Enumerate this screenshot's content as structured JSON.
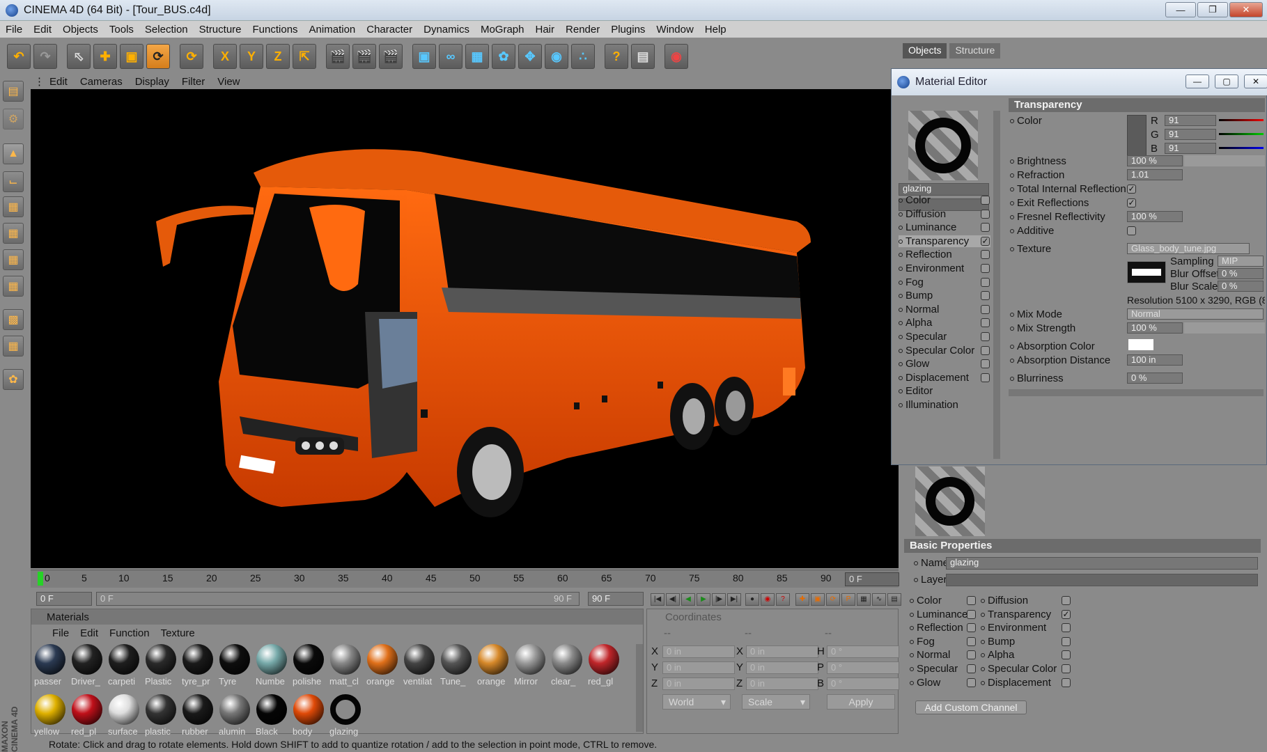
{
  "app": {
    "title": "CINEMA 4D (64 Bit) - [Tour_BUS.c4d]"
  },
  "menu": [
    "File",
    "Edit",
    "Objects",
    "Tools",
    "Selection",
    "Structure",
    "Functions",
    "Animation",
    "Character",
    "Dynamics",
    "MoGraph",
    "Hair",
    "Render",
    "Plugins",
    "Window",
    "Help"
  ],
  "toolbar": {
    "x_label": "X",
    "y_label": "Y",
    "z_label": "Z"
  },
  "viewport": {
    "menu": [
      "Edit",
      "Cameras",
      "Display",
      "Filter",
      "View"
    ]
  },
  "timeline": {
    "ticks": [
      "0",
      "5",
      "10",
      "15",
      "20",
      "25",
      "30",
      "35",
      "40",
      "45",
      "50",
      "55",
      "60",
      "65",
      "70",
      "75",
      "80",
      "85",
      "90"
    ],
    "current_frame": "0 F",
    "start": "0 F",
    "slider_start": "0 F",
    "slider_end": "90 F",
    "end": "90 F"
  },
  "materials": {
    "title": "Materials",
    "menu": [
      "File",
      "Edit",
      "Function",
      "Texture"
    ],
    "row1": [
      {
        "label": "passer",
        "color": "#2b3a52"
      },
      {
        "label": "Driver_",
        "color": "#222"
      },
      {
        "label": "carpeti",
        "color": "#1e1e1e"
      },
      {
        "label": "Plastic",
        "color": "#2a2a2a"
      },
      {
        "label": "tyre_pr",
        "color": "#1a1a1a"
      },
      {
        "label": "Tyre",
        "color": "#0e0e0e"
      },
      {
        "label": "Numbe",
        "color": "#7aa"
      },
      {
        "label": "polishe",
        "color": "#0a0a0a"
      },
      {
        "label": "matt_cl",
        "color": "#888"
      },
      {
        "label": "orange",
        "color": "#e0701a"
      },
      {
        "label": "ventilat",
        "color": "#444"
      },
      {
        "label": "Tune_",
        "color": "#555"
      },
      {
        "label": "orange",
        "color": "#d7892a"
      },
      {
        "label": "Mirror",
        "color": "#999"
      },
      {
        "label": "clear_",
        "color": "#8a8a8a"
      },
      {
        "label": "red_gl",
        "color": "#c0262a"
      }
    ],
    "row2": [
      {
        "label": "yellow",
        "color": "#e0b100"
      },
      {
        "label": "red_pl",
        "color": "#c0101a"
      },
      {
        "label": "surface",
        "color": "#ddd"
      },
      {
        "label": "plastic",
        "color": "#333"
      },
      {
        "label": "rubber",
        "color": "#1a1a1a"
      },
      {
        "label": "alumin",
        "color": "#777"
      },
      {
        "label": "Black",
        "color": "#050505"
      },
      {
        "label": "body",
        "color": "#e04a08"
      },
      {
        "label": "glazing",
        "color": "#8a8a8a"
      }
    ]
  },
  "coordinates": {
    "title": "Coordinates",
    "col1": [
      "--",
      "--",
      "--"
    ],
    "axes_pos": [
      "X",
      "Y",
      "Z"
    ],
    "axes_size": [
      "X",
      "Y",
      "Z"
    ],
    "axes_rot": [
      "H",
      "P",
      "B"
    ],
    "pos_vals": [
      "0 in",
      "0 in",
      "0 in"
    ],
    "size_vals": [
      "0 in",
      "0 in",
      "0 in"
    ],
    "rot_vals": [
      "0 °",
      "0 °",
      "0 °"
    ],
    "mode1": "World",
    "mode2": "Scale",
    "apply": "Apply"
  },
  "status": "Rotate: Click and drag to rotate elements. Hold down SHIFT to add to quantize rotation / add to the selection in point mode, CTRL to remove.",
  "objects_tabs": [
    "Objects",
    "Structure"
  ],
  "material_editor": {
    "title": "Material Editor",
    "name": "glazing",
    "section": "Transparency",
    "channels": [
      {
        "label": "Color",
        "on": false
      },
      {
        "label": "Diffusion",
        "on": false
      },
      {
        "label": "Luminance",
        "on": false
      },
      {
        "label": "Transparency",
        "on": true
      },
      {
        "label": "Reflection",
        "on": false
      },
      {
        "label": "Environment",
        "on": false
      },
      {
        "label": "Fog",
        "on": false
      },
      {
        "label": "Bump",
        "on": false
      },
      {
        "label": "Normal",
        "on": false
      },
      {
        "label": "Alpha",
        "on": false
      },
      {
        "label": "Specular",
        "on": false
      },
      {
        "label": "Specular Color",
        "on": false
      },
      {
        "label": "Glow",
        "on": false
      },
      {
        "label": "Displacement",
        "on": false
      },
      {
        "label": "Editor",
        "on": false
      },
      {
        "label": "Illumination",
        "on": false
      }
    ],
    "color_label": "Color",
    "r": "91",
    "g": "91",
    "b": "91",
    "r_label": "R",
    "g_label": "G",
    "b_label": "B",
    "brightness_label": "Brightness",
    "brightness": "100 %",
    "refraction_label": "Refraction",
    "refraction": "1.01",
    "tir_label": "Total Internal Reflection",
    "exit_label": "Exit Reflections",
    "fresnel_label": "Fresnel Reflectivity",
    "fresnel": "100 %",
    "additive_label": "Additive",
    "texture_label": "Texture",
    "texture": "Glass_body_tune.jpg",
    "sampling_label": "Sampling",
    "sampling": "MIP",
    "bluroffset_label": "Blur Offset",
    "bluroffset": "0 %",
    "blurscale_label": "Blur Scale",
    "blurscale": "0 %",
    "resolution": "Resolution 5100 x 3290, RGB (8",
    "mixmode_label": "Mix Mode",
    "mixmode": "Normal",
    "mixstrength_label": "Mix Strength",
    "mixstrength": "100 %",
    "absorption_color_label": "Absorption Color",
    "absorption_distance_label": "Absorption Distance",
    "absorption_distance": "100 in",
    "blurriness_label": "Blurriness",
    "blurriness": "0 %"
  },
  "attributes": {
    "section": "Basic Properties",
    "name_label": "Name",
    "name": "glazing",
    "layer_label": "Layer",
    "left": [
      {
        "label": "Color",
        "on": false
      },
      {
        "label": "Luminance",
        "on": false
      },
      {
        "label": "Reflection",
        "on": false
      },
      {
        "label": "Fog",
        "on": false
      },
      {
        "label": "Normal",
        "on": false
      },
      {
        "label": "Specular",
        "on": false
      },
      {
        "label": "Glow",
        "on": false
      }
    ],
    "right": [
      {
        "label": "Diffusion",
        "on": false
      },
      {
        "label": "Transparency",
        "on": true
      },
      {
        "label": "Environment",
        "on": false
      },
      {
        "label": "Bump",
        "on": false
      },
      {
        "label": "Alpha",
        "on": false
      },
      {
        "label": "Specular Color",
        "on": false
      },
      {
        "label": "Displacement",
        "on": false
      }
    ],
    "add_channel": "Add Custom Channel"
  },
  "side_logo": "MAXON CINEMA 4D"
}
